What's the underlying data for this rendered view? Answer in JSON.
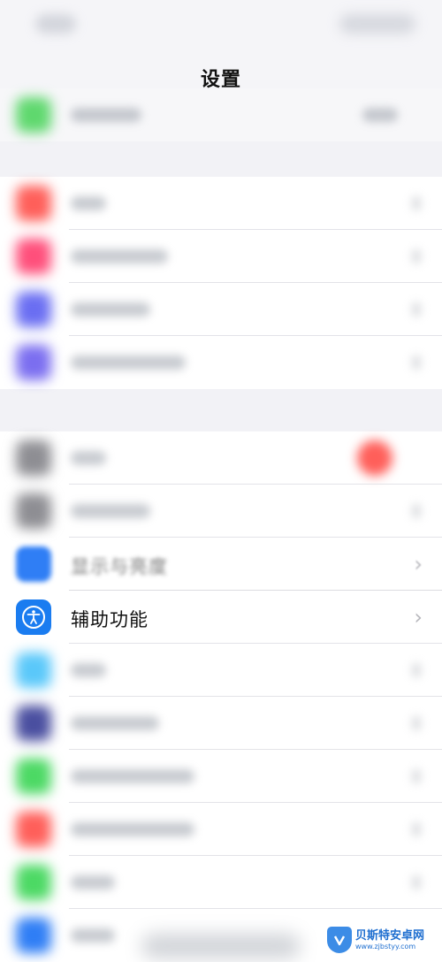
{
  "nav": {
    "title": "设置"
  },
  "accessibility_row": {
    "label": "辅助功能",
    "chevron": "›"
  },
  "display_row_partial": {
    "label": "显示与亮度",
    "chevron": "›"
  },
  "colors": {
    "accessibility_icon": "#1a7cf0",
    "background": "#f2f2f6"
  },
  "watermark": {
    "line1": "贝斯特安卓网",
    "line2": "www.zjbstyy.com"
  }
}
